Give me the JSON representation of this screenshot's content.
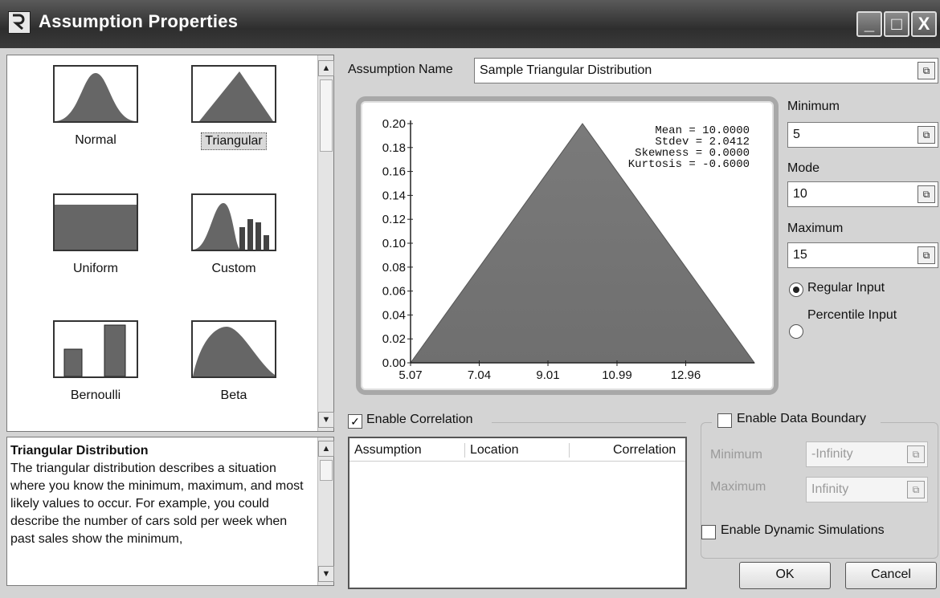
{
  "window": {
    "title": "Assumption Properties",
    "minimize_label": "_",
    "maximize_label": "□",
    "close_label": "X"
  },
  "gallery": {
    "items": [
      {
        "name": "Normal",
        "icon": "normal-dist-icon"
      },
      {
        "name": "Triangular",
        "icon": "triangular-dist-icon",
        "selected": true
      },
      {
        "name": "Uniform",
        "icon": "uniform-dist-icon"
      },
      {
        "name": "Custom",
        "icon": "custom-dist-icon"
      },
      {
        "name": "Bernoulli",
        "icon": "bernoulli-dist-icon"
      },
      {
        "name": "Beta",
        "icon": "beta-dist-icon"
      }
    ]
  },
  "description": {
    "title": "Triangular Distribution",
    "text": "The triangular distribution describes a situation where you know the minimum, maximum, and most likely values to occur. For example, you could describe the number of cars sold per week when past sales show the minimum,"
  },
  "assumption_name": {
    "label": "Assumption Name",
    "value": "Sample Triangular Distribution"
  },
  "chart_data": {
    "type": "area",
    "x": [
      5.07,
      10.0,
      14.93
    ],
    "y": [
      0.0,
      0.2,
      0.0
    ],
    "x_ticks": [
      "5.07",
      "7.04",
      "9.01",
      "10.99",
      "12.96"
    ],
    "y_ticks": [
      "0.00",
      "0.02",
      "0.04",
      "0.06",
      "0.08",
      "0.10",
      "0.12",
      "0.14",
      "0.16",
      "0.18",
      "0.20"
    ],
    "ylim": [
      0,
      0.2
    ],
    "xlim": [
      5.07,
      14.93
    ],
    "stats": [
      {
        "label": "Mean",
        "value": "10.0000"
      },
      {
        "label": "Stdev",
        "value": "2.0412"
      },
      {
        "label": "Skewness",
        "value": "0.0000"
      },
      {
        "label": "Kurtosis",
        "value": "-0.6000"
      }
    ],
    "fill_color": "#6f6f6f"
  },
  "params": {
    "minimum": {
      "label": "Minimum",
      "value": "5"
    },
    "mode": {
      "label": "Mode",
      "value": "10"
    },
    "maximum": {
      "label": "Maximum",
      "value": "15"
    },
    "input_mode": {
      "regular": {
        "label": "Regular Input",
        "selected": true
      },
      "percentile": {
        "label": "Percentile Input",
        "selected": false
      }
    }
  },
  "correlation": {
    "enable_label": "Enable Correlation",
    "enabled": true,
    "columns": [
      "Assumption",
      "Location",
      "Correlation"
    ]
  },
  "boundary": {
    "enable_label": "Enable Data Boundary",
    "min_label": "Minimum",
    "min_value": "-Infinity",
    "max_label": "Maximum",
    "max_value": "Infinity"
  },
  "dynamic": {
    "label": "Enable Dynamic Simulations"
  },
  "buttons": {
    "ok": "OK",
    "cancel": "Cancel"
  }
}
